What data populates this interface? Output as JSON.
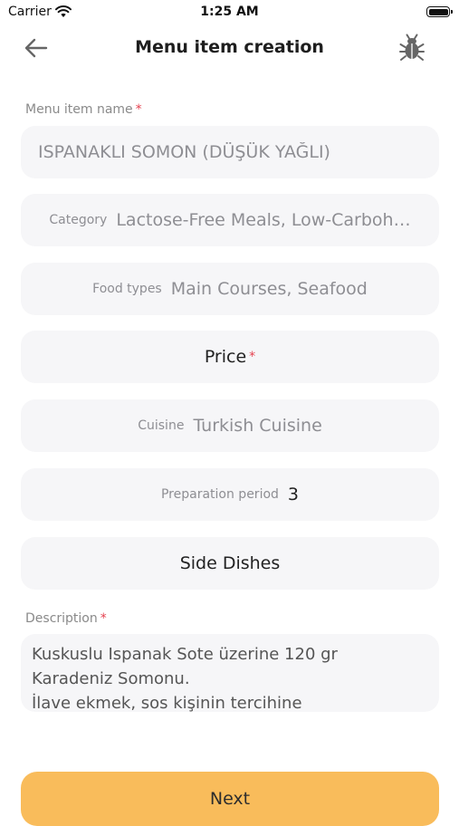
{
  "status_bar": {
    "carrier": "Carrier",
    "time": "1:25 AM"
  },
  "nav": {
    "title": "Menu item creation",
    "back_icon": "back-arrow-icon",
    "bug_icon": "bug-icon"
  },
  "form": {
    "name_label": "Menu item name",
    "required_mark": "*",
    "name_value": "ISPANAKLI SOMON (DÜŞÜK YAĞLI)",
    "category_prefix": "Category",
    "category_value": "Lactose-Free Meals, Low-Carboh…",
    "food_types_prefix": "Food types",
    "food_types_value": "Main Courses, Seafood",
    "price_label": "Price",
    "cuisine_prefix": "Cuisine",
    "cuisine_value": "Turkish Cuisine",
    "prep_prefix": "Preparation period",
    "prep_value": "3",
    "side_dishes_label": "Side Dishes",
    "description_label": "Description",
    "description_lines": [
      "Kuskuslu Ispanak Sote üzerine 120 gr",
      "Karadeniz Somonu.",
      "İlave ekmek, sos kişinin tercihine"
    ]
  },
  "footer": {
    "next_label": "Next"
  },
  "colors": {
    "accent": "#f9bc5b",
    "required": "#e5414f",
    "field_bg": "#f6f6f8"
  }
}
